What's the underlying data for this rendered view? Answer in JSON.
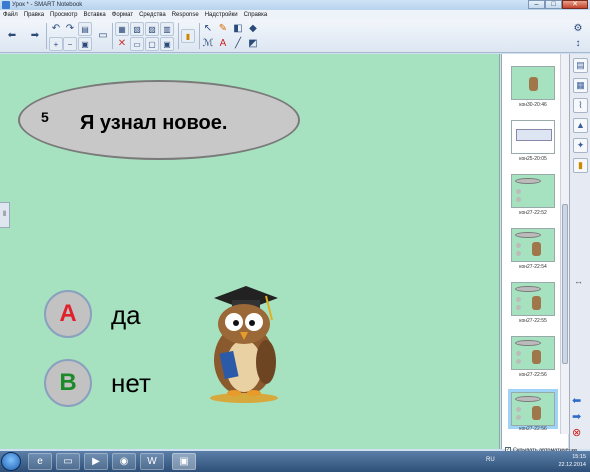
{
  "window": {
    "title": "Урок * - SMART Notebook",
    "minimize": "–",
    "maximize": "□",
    "close": "✕"
  },
  "menu": [
    "Файл",
    "Правка",
    "Просмотр",
    "Вставка",
    "Формат",
    "Средства",
    "Response",
    "Надстройки",
    "Справка"
  ],
  "slide": {
    "number": "5",
    "question": "Я узнал новое.",
    "answers": [
      {
        "letter": "A",
        "text": "да"
      },
      {
        "letter": "B",
        "text": "нет"
      }
    ]
  },
  "pages": [
    {
      "label": "кон30-20:46"
    },
    {
      "label": "кон25-20:05"
    },
    {
      "label": "кон27-22:52"
    },
    {
      "label": "кон27-22:54"
    },
    {
      "label": "кон27-22:55"
    },
    {
      "label": "кон27-22:56"
    },
    {
      "label": "кон27-22:56"
    }
  ],
  "page_sorter": {
    "autohide_label": "Скрывать автоматически",
    "collapse_glyph": "↔"
  },
  "taskbar": {
    "lang": "RU",
    "time": "15:15",
    "date": "22.12.2014"
  },
  "colors": {
    "canvas": "#a6e2c0",
    "answer_a": "#e0202a",
    "answer_b": "#1d8a2a"
  }
}
